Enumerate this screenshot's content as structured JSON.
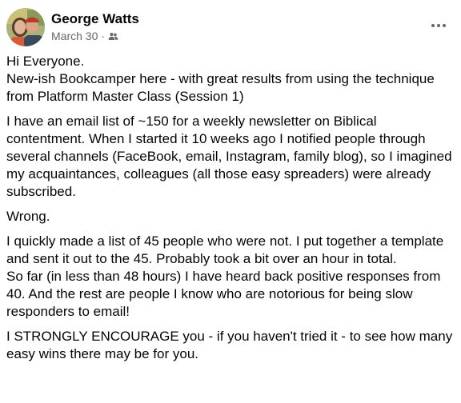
{
  "post": {
    "author": "George Watts",
    "date": "March 30",
    "separator": "·",
    "privacy_icon": "friends-icon",
    "more_icon": "more-options-icon",
    "paragraphs": [
      "Hi Everyone.\nNew-ish Bookcamper here - with great results from using the technique from Platform Master Class (Session 1)",
      "I have an email list of ~150 for a weekly newsletter on Biblical contentment.  When I started it 10 weeks ago I notified people through several channels (FaceBook, email, Instagram, family blog), so I imagined my acquaintances, colleagues  (all those easy spreaders) were already subscribed.",
      "Wrong.",
      "I quickly made a list of 45 people who were not. I put together a template and sent it out to the 45. Probably took a bit over an hour in total.\nSo far (in less than 48 hours) I have heard back positive responses from 40. And the rest are people I know who are notorious for being slow responders to email!",
      "I STRONGLY ENCOURAGE you - if you haven't tried it - to see how many easy wins there may be for you."
    ]
  }
}
